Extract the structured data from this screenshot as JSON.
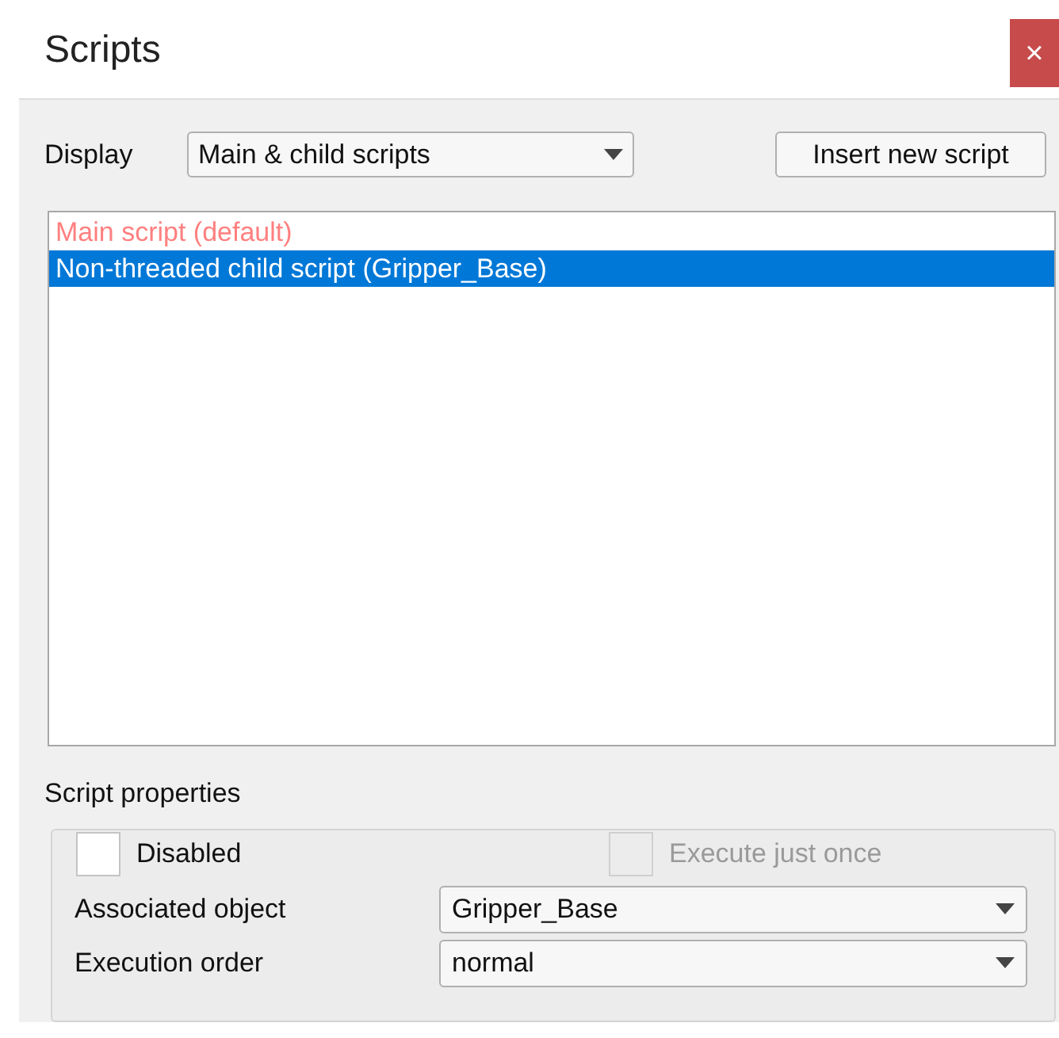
{
  "window": {
    "title": "Scripts",
    "close": "×"
  },
  "display": {
    "label": "Display",
    "value": "Main & child scripts"
  },
  "insert_button": "Insert new script",
  "scripts": [
    {
      "label": "Main script (default)",
      "kind": "main",
      "selected": false
    },
    {
      "label": "Non-threaded child script (Gripper_Base)",
      "kind": "child",
      "selected": true
    }
  ],
  "properties": {
    "title": "Script properties",
    "checkboxes": [
      {
        "label": "Disabled",
        "checked": false,
        "disabled": false
      },
      {
        "label": "Execute just once",
        "checked": false,
        "disabled": true
      }
    ],
    "fields": [
      {
        "label": "Associated object",
        "value": "Gripper_Base"
      },
      {
        "label": "Execution order",
        "value": "normal"
      }
    ]
  }
}
